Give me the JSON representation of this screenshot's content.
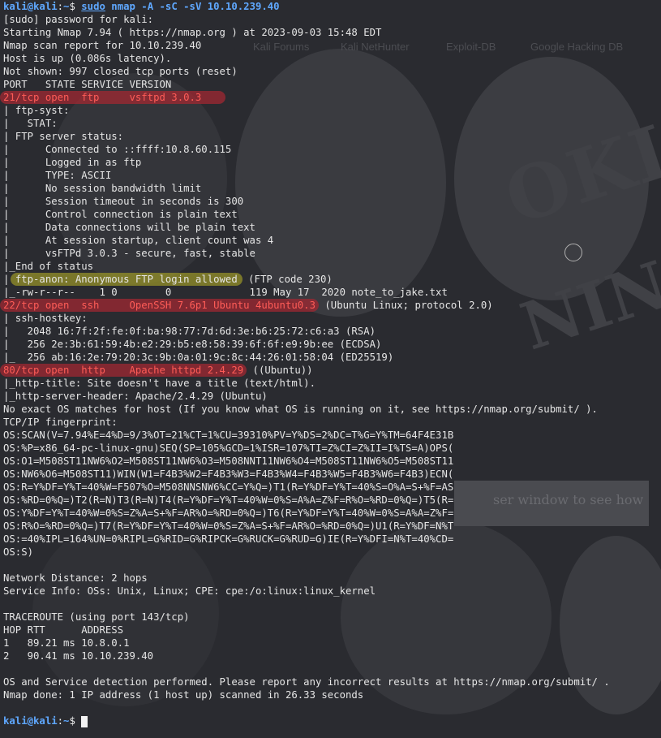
{
  "prompt": {
    "user": "kali@kali",
    "sep": ":",
    "path": "~",
    "symbol": "$"
  },
  "command": {
    "sudo": "sudo",
    "rest": " nmap -A -sC -sV 10.10.239.40"
  },
  "output": [
    "[sudo] password for kali:",
    "Starting Nmap 7.94 ( https://nmap.org ) at 2023-09-03 15:48 EDT",
    "Nmap scan report for 10.10.239.40",
    "Host is up (0.086s latency).",
    "Not shown: 997 closed tcp ports (reset)",
    "PORT   STATE SERVICE VERSION"
  ],
  "ftp": {
    "port_line": "21/tcp open  ftp     vsftpd 3.0.3",
    "details": [
      "| ftp-syst:",
      "|   STAT:",
      "| FTP server status:",
      "|      Connected to ::ffff:10.8.60.115",
      "|      Logged in as ftp",
      "|      TYPE: ASCII",
      "|      No session bandwidth limit",
      "|      Session timeout in seconds is 300",
      "|      Control connection is plain text",
      "|      Data connections will be plain text",
      "|      At session startup, client count was 4",
      "|      vsFTPd 3.0.3 - secure, fast, stable",
      "|_End of status"
    ],
    "anon_prefix": "| ",
    "anon_hl": "ftp-anon: Anonymous FTP login allowed",
    "anon_rest": " (FTP code 230)",
    "file_line": "|_-rw-r--r--    1 0        0             119 May 17  2020 note_to_jake.txt"
  },
  "ssh": {
    "port_line": "22/tcp open  ssh     OpenSSH 7.6p1 Ubuntu 4ubuntu0.3",
    "port_rest": " (Ubuntu Linux; protocol 2.0)",
    "details": [
      "| ssh-hostkey:",
      "|   2048 16:7f:2f:fe:0f:ba:98:77:7d:6d:3e:b6:25:72:c6:a3 (RSA)",
      "|   256 2e:3b:61:59:4b:e2:29:b5:e8:58:39:6f:6f:e9:9b:ee (ECDSA)",
      "|_  256 ab:16:2e:79:20:3c:9b:0a:01:9c:8c:44:26:01:58:04 (ED25519)"
    ]
  },
  "http": {
    "port_line": "80/tcp open  http    Apache httpd 2.4.29",
    "port_rest": " ((Ubuntu))",
    "details": [
      "|_http-title: Site doesn't have a title (text/html).",
      "|_http-server-header: Apache/2.4.29 (Ubuntu)"
    ]
  },
  "tail": [
    "No exact OS matches for host (If you know what OS is running on it, see https://nmap.org/submit/ ).",
    "TCP/IP fingerprint:",
    "OS:SCAN(V=7.94%E=4%D=9/3%OT=21%CT=1%CU=39310%PV=Y%DS=2%DC=T%G=Y%TM=64F4E31B",
    "OS:%P=x86_64-pc-linux-gnu)SEQ(SP=105%GCD=1%ISR=107%TI=Z%CI=Z%II=I%TS=A)OPS(",
    "OS:O1=M508ST11NW6%O2=M508ST11NW6%O3=M508NNT11NW6%O4=M508ST11NW6%O5=M508ST11",
    "OS:NW6%O6=M508ST11)WIN(W1=F4B3%W2=F4B3%W3=F4B3%W4=F4B3%W5=F4B3%W6=F4B3)ECN(",
    "OS:R=Y%DF=Y%T=40%W=F507%O=M508NNSNW6%CC=Y%Q=)T1(R=Y%DF=Y%T=40%S=O%A=S+%F=AS",
    "OS:%RD=0%Q=)T2(R=N)T3(R=N)T4(R=Y%DF=Y%T=40%W=0%S=A%A=Z%F=R%O=%RD=0%Q=)T5(R=",
    "OS:Y%DF=Y%T=40%W=0%S=Z%A=S+%F=AR%O=%RD=0%Q=)T6(R=Y%DF=Y%T=40%W=0%S=A%A=Z%F=",
    "OS:R%O=%RD=0%Q=)T7(R=Y%DF=Y%T=40%W=0%S=Z%A=S+%F=AR%O=%RD=0%Q=)U1(R=Y%DF=N%T",
    "OS:=40%IPL=164%UN=0%RIPL=G%RID=G%RIPCK=G%RUCK=G%RUD=G)IE(R=Y%DFI=N%T=40%CD=",
    "OS:S)",
    "",
    "Network Distance: 2 hops",
    "Service Info: OSs: Unix, Linux; CPE: cpe:/o:linux:linux_kernel",
    "",
    "TRACEROUTE (using port 143/tcp)",
    "HOP RTT      ADDRESS",
    "1   89.21 ms 10.8.0.1",
    "2   90.41 ms 10.10.239.40",
    "",
    "OS and Service detection performed. Please report any incorrect results at https://nmap.org/submit/ .",
    "Nmap done: 1 IP address (1 host up) scanned in 26.33 seconds",
    ""
  ],
  "background": {
    "bookmarks": [
      "Kali Forums",
      "Kali NetHunter",
      "Exploit-DB",
      "Google Hacking DB"
    ],
    "panel_text": "ser window to see how",
    "word1": "OKLY",
    "word2": "NINE"
  }
}
